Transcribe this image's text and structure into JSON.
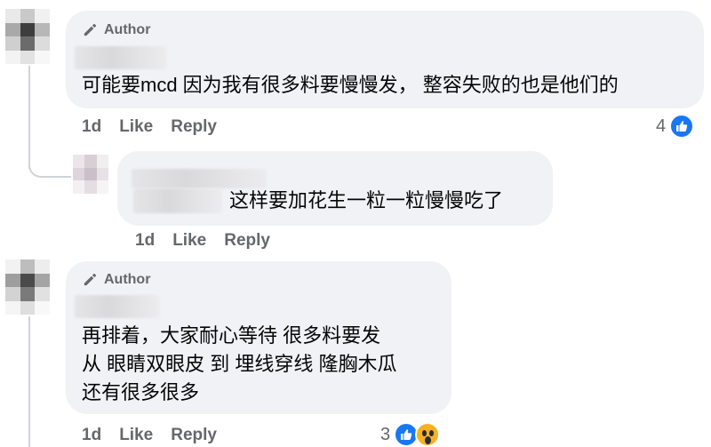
{
  "comments": [
    {
      "author_badge": "Author",
      "text": "可能要mcd 因为我有很多料要慢慢发， 整容失败的也是他们的",
      "time": "1d",
      "like_label": "Like",
      "reply_label": "Reply",
      "reaction_count": "4",
      "reactions": [
        "like"
      ]
    },
    {
      "text": "这样要加花生一粒一粒慢慢吃了",
      "time": "1d",
      "like_label": "Like",
      "reply_label": "Reply"
    },
    {
      "author_badge": "Author",
      "text_lines": [
        "再排着，大家耐心等待 很多料要发",
        "从 眼睛双眼皮 到 埋线穿线 隆胸木瓜",
        "还有很多很多"
      ],
      "time": "1d",
      "like_label": "Like",
      "reply_label": "Reply",
      "reaction_count": "3",
      "reactions": [
        "like",
        "wow"
      ]
    }
  ],
  "colors": {
    "bubble": "#f0f2f5",
    "secondary_text": "#65676b",
    "like_blue": "#1877f2",
    "wow_yellow": "#f7b125"
  },
  "icons": [
    "pencil-icon",
    "like-reaction-icon",
    "wow-reaction-icon"
  ]
}
